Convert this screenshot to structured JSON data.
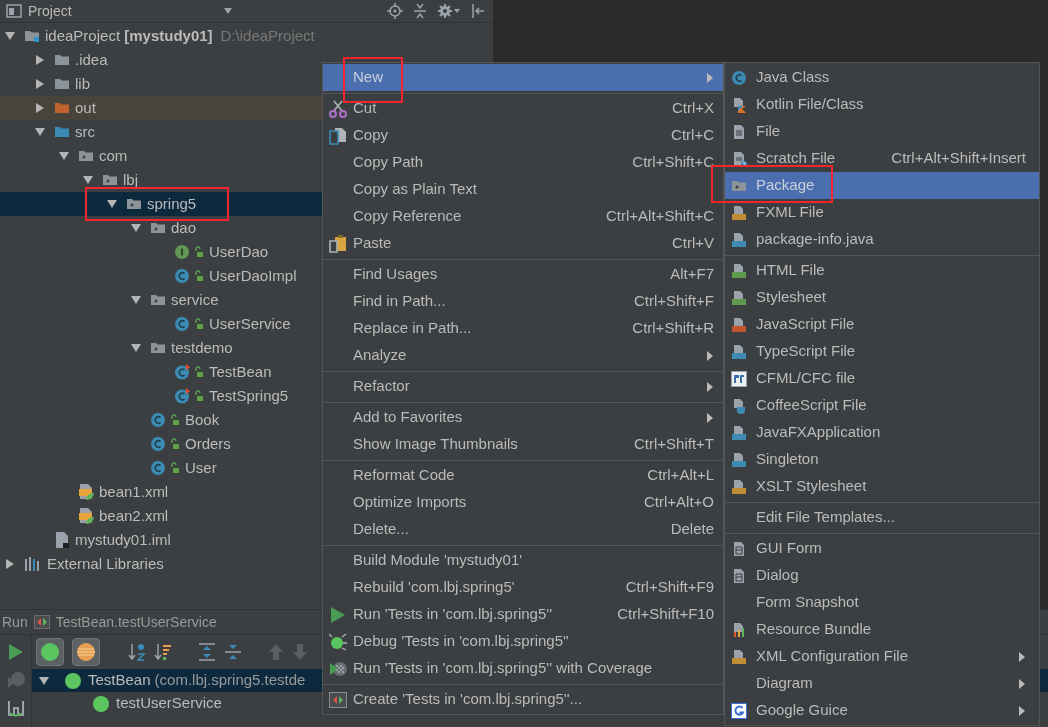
{
  "project_panel": {
    "title": "Project"
  },
  "tree": [
    {
      "label": "ideaProject **[mystudy01]**",
      "path": "D:\\ideaProject",
      "kind": "module",
      "expanded": true,
      "selected": false,
      "children": [
        {
          "label": ".idea",
          "kind": "folder",
          "expanded": false,
          "selected": false
        },
        {
          "label": "lib",
          "kind": "folder",
          "expanded": false,
          "selected": false
        },
        {
          "label": "out",
          "kind": "excluded-folder",
          "expanded": false,
          "selected": false
        },
        {
          "label": "src",
          "kind": "source-folder",
          "expanded": true,
          "selected": false,
          "children": [
            {
              "label": "com",
              "kind": "package",
              "expanded": true,
              "selected": false,
              "children": [
                {
                  "label": "lbj",
                  "kind": "package",
                  "expanded": true,
                  "selected": false,
                  "children": [
                    {
                      "label": "spring5",
                      "kind": "package",
                      "expanded": true,
                      "selected": true,
                      "children": [
                        {
                          "label": "dao",
                          "kind": "package",
                          "expanded": true,
                          "selected": false,
                          "children": [
                            {
                              "label": "UserDao",
                              "kind": "interface",
                              "selected": false
                            },
                            {
                              "label": "UserDaoImpl",
                              "kind": "class",
                              "selected": false
                            }
                          ]
                        },
                        {
                          "label": "service",
                          "kind": "package",
                          "expanded": true,
                          "selected": false,
                          "children": [
                            {
                              "label": "UserService",
                              "kind": "class",
                              "selected": false
                            }
                          ]
                        },
                        {
                          "label": "testdemo",
                          "kind": "package",
                          "expanded": true,
                          "selected": false,
                          "children": [
                            {
                              "label": "TestBean",
                              "kind": "test-class",
                              "selected": false
                            },
                            {
                              "label": "TestSpring5",
                              "kind": "test-class",
                              "selected": false
                            }
                          ]
                        },
                        {
                          "label": "Book",
                          "kind": "class",
                          "selected": false
                        },
                        {
                          "label": "Orders",
                          "kind": "class",
                          "selected": false
                        },
                        {
                          "label": "User",
                          "kind": "class",
                          "selected": false
                        }
                      ]
                    }
                  ]
                }
              ]
            },
            {
              "label": "bean1.xml",
              "kind": "spring-xml",
              "selected": false
            },
            {
              "label": "bean2.xml",
              "kind": "spring-xml",
              "selected": false
            }
          ]
        },
        {
          "label": "mystudy01.iml",
          "kind": "module-file",
          "selected": false
        }
      ]
    },
    {
      "label": "External Libraries",
      "kind": "libraries",
      "expanded": false,
      "selected": false
    }
  ],
  "run_panel": {
    "title": "Run",
    "configuration": "TestBean.testUserService",
    "toggles": [
      {
        "pressed": true
      },
      {
        "pressed": true
      }
    ],
    "results": [
      {
        "label": "TestBean",
        "detail": "(com.lbj.spring5.testde",
        "expanded": true,
        "selected": true,
        "children": [
          {
            "label": "testUserService",
            "selected": false
          }
        ]
      }
    ]
  },
  "context_menu": [
    [
      {
        "label": "New",
        "has_submenu": true,
        "selected": true
      }
    ],
    [
      {
        "label": "Cut",
        "shortcut": "Ctrl+X",
        "has_submenu": false,
        "selected": false
      },
      {
        "label": "Copy",
        "shortcut": "Ctrl+C",
        "has_submenu": false,
        "selected": false
      },
      {
        "label": "Copy Path",
        "shortcut": "Ctrl+Shift+C",
        "has_submenu": false,
        "selected": false
      },
      {
        "label": "Copy as Plain Text",
        "has_submenu": false,
        "selected": false
      },
      {
        "label": "Copy Reference",
        "shortcut": "Ctrl+Alt+Shift+C",
        "has_submenu": false,
        "selected": false
      },
      {
        "label": "Paste",
        "shortcut": "Ctrl+V",
        "has_submenu": false,
        "selected": false
      }
    ],
    [
      {
        "label": "Find Usages",
        "shortcut": "Alt+F7",
        "has_submenu": false,
        "selected": false
      },
      {
        "label": "Find in Path...",
        "shortcut": "Ctrl+Shift+F",
        "has_submenu": false,
        "selected": false
      },
      {
        "label": "Replace in Path...",
        "shortcut": "Ctrl+Shift+R",
        "has_submenu": false,
        "selected": false
      },
      {
        "label": "Analyze",
        "has_submenu": true,
        "selected": false
      }
    ],
    [
      {
        "label": "Refactor",
        "has_submenu": true,
        "selected": false
      }
    ],
    [
      {
        "label": "Add to Favorites",
        "has_submenu": true,
        "selected": false
      },
      {
        "label": "Show Image Thumbnails",
        "shortcut": "Ctrl+Shift+T",
        "has_submenu": false,
        "selected": false
      }
    ],
    [
      {
        "label": "Reformat Code",
        "shortcut": "Ctrl+Alt+L",
        "has_submenu": false,
        "selected": false
      },
      {
        "label": "Optimize Imports",
        "shortcut": "Ctrl+Alt+O",
        "has_submenu": false,
        "selected": false
      },
      {
        "label": "Delete...",
        "shortcut": "Delete",
        "has_submenu": false,
        "selected": false
      }
    ],
    [
      {
        "label": "Build Module 'mystudy01'",
        "has_submenu": false,
        "selected": false
      },
      {
        "label": "Rebuild 'com.lbj.spring5'",
        "shortcut": "Ctrl+Shift+F9",
        "has_submenu": false,
        "selected": false
      },
      {
        "label": "Run 'Tests in 'com.lbj.spring5''",
        "shortcut": "Ctrl+Shift+F10",
        "has_submenu": false,
        "selected": false
      },
      {
        "label": "Debug 'Tests in 'com.lbj.spring5''",
        "has_submenu": false,
        "selected": false
      },
      {
        "label": "Run 'Tests in 'com.lbj.spring5'' with Coverage",
        "has_submenu": false,
        "selected": false
      }
    ],
    [
      {
        "label": "Create 'Tests in 'com.lbj.spring5''...",
        "has_submenu": false,
        "selected": false
      }
    ]
  ],
  "new_submenu": [
    [
      {
        "label": "Java Class",
        "has_submenu": false,
        "selected": false
      },
      {
        "label": "Kotlin File/Class",
        "has_submenu": false,
        "selected": false
      },
      {
        "label": "File",
        "has_submenu": false,
        "selected": false
      },
      {
        "label": "Scratch File",
        "shortcut": "Ctrl+Alt+Shift+Insert",
        "has_submenu": false,
        "selected": false
      },
      {
        "label": "Package",
        "has_submenu": false,
        "selected": true
      },
      {
        "label": "FXML File",
        "has_submenu": false,
        "selected": false
      },
      {
        "label": "package-info.java",
        "has_submenu": false,
        "selected": false
      }
    ],
    [
      {
        "label": "HTML File",
        "has_submenu": false,
        "selected": false
      },
      {
        "label": "Stylesheet",
        "has_submenu": false,
        "selected": false
      },
      {
        "label": "JavaScript File",
        "has_submenu": false,
        "selected": false
      },
      {
        "label": "TypeScript File",
        "has_submenu": false,
        "selected": false
      },
      {
        "label": "CFML/CFC file",
        "has_submenu": false,
        "selected": false
      },
      {
        "label": "CoffeeScript File",
        "has_submenu": false,
        "selected": false
      },
      {
        "label": "JavaFXApplication",
        "has_submenu": false,
        "selected": false
      },
      {
        "label": "Singleton",
        "has_submenu": false,
        "selected": false
      },
      {
        "label": "XSLT Stylesheet",
        "has_submenu": false,
        "selected": false
      }
    ],
    [
      {
        "label": "Edit File Templates...",
        "has_submenu": false,
        "selected": false
      }
    ],
    [
      {
        "label": "GUI Form",
        "has_submenu": false,
        "selected": false
      },
      {
        "label": "Dialog",
        "has_submenu": false,
        "selected": false
      },
      {
        "label": "Form Snapshot",
        "has_submenu": false,
        "selected": false
      },
      {
        "label": "Resource Bundle",
        "has_submenu": false,
        "selected": false
      },
      {
        "label": "XML Configuration File",
        "has_submenu": true,
        "selected": false
      },
      {
        "label": "Diagram",
        "has_submenu": true,
        "selected": false
      },
      {
        "label": "Google Guice",
        "has_submenu": true,
        "selected": false
      }
    ]
  ]
}
